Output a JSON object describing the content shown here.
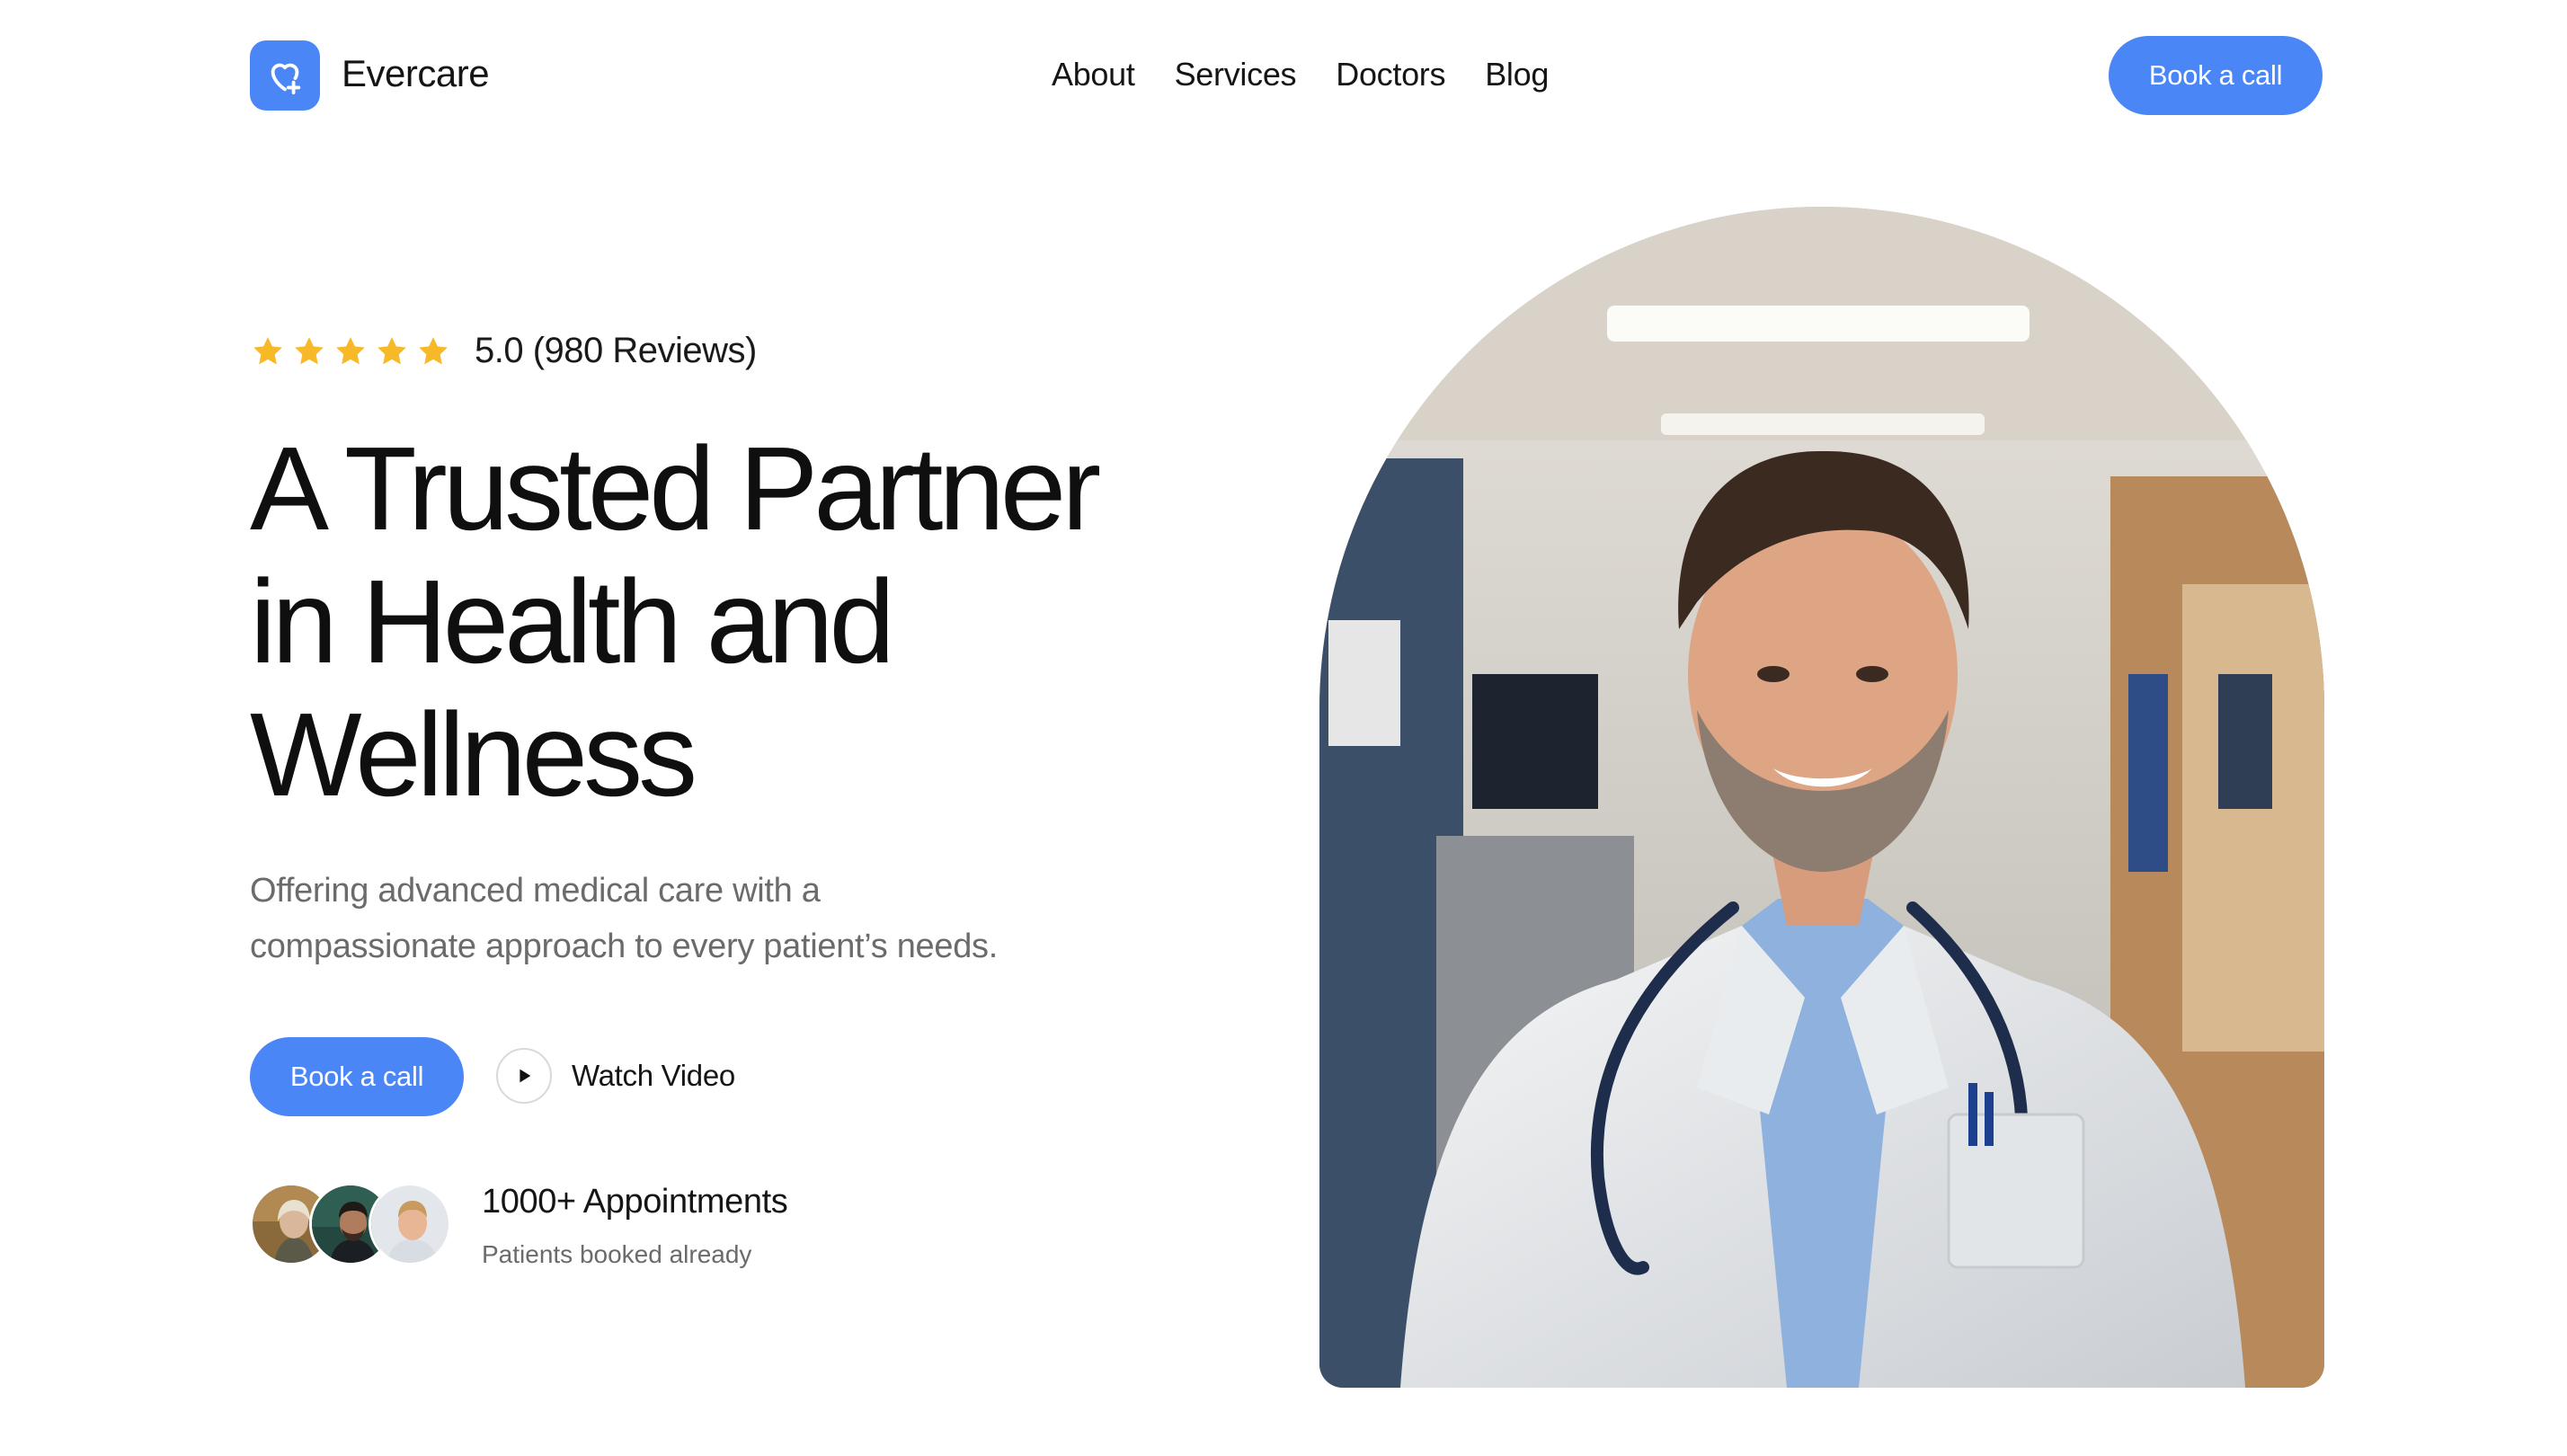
{
  "brand": {
    "name": "Evercare",
    "logo_icon": "heart-plus-icon",
    "accent_color": "#4a86f5"
  },
  "nav": {
    "items": [
      "About",
      "Services",
      "Doctors",
      "Blog"
    ]
  },
  "header": {
    "cta_label": "Book a call"
  },
  "rating": {
    "stars": 5,
    "text": "5.0 (980 Reviews)",
    "star_color": "#f7b928"
  },
  "hero": {
    "title_lines": [
      "A Trusted Partner",
      "in Health and",
      "Wellness"
    ],
    "subtitle_lines": [
      "Offering advanced medical care with a",
      "compassionate approach to every patient’s needs."
    ],
    "cta_label": "Book a call",
    "video_label": "Watch Video",
    "video_icon": "play-icon"
  },
  "social_proof": {
    "title": "1000+ Appointments",
    "subtitle": "Patients booked already",
    "avatar_count": 3
  },
  "image": {
    "subject": "doctor-photo"
  }
}
